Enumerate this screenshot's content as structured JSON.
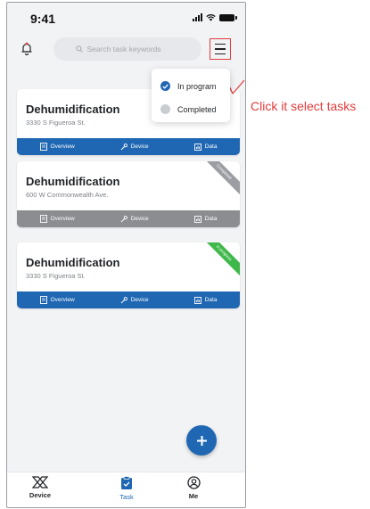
{
  "status_bar": {
    "time": "9:41"
  },
  "header": {
    "search_placeholder": "Search task keywords",
    "icons": {
      "notification": "bell-alert-icon",
      "menu": "hamburger-menu-icon",
      "search": "search-icon"
    }
  },
  "filter_menu": {
    "options": [
      {
        "label": "In program",
        "checked": true
      },
      {
        "label": "Completed",
        "checked": false
      }
    ]
  },
  "tasks": [
    {
      "title": "Dehumidification",
      "address": "3330 S Figueroa St.",
      "status": "",
      "bar_color": "#1f67b2",
      "ribbon_color": "",
      "actions": [
        "Overview",
        "Device",
        "Data"
      ]
    },
    {
      "title": "Dehumidification",
      "address": "600 W Commonwealth Ave.",
      "status": "Completed",
      "bar_color": "#8b8d91",
      "ribbon_color": "#9a9da1",
      "actions": [
        "Overview",
        "Device",
        "Data"
      ]
    },
    {
      "title": "Dehumidification",
      "address": "3330 S Figueroa St.",
      "status": "In progress",
      "bar_color": "#1f67b2",
      "ribbon_color": "#3fb84a",
      "actions": [
        "Overview",
        "Device",
        "Data"
      ]
    }
  ],
  "bottom_nav": {
    "items": [
      {
        "label": "Device",
        "icon": "device-logo-icon",
        "active": false
      },
      {
        "label": "Task",
        "icon": "clipboard-check-icon",
        "active": true
      },
      {
        "label": "Me",
        "icon": "user-circle-icon",
        "active": false
      }
    ]
  },
  "annotation": {
    "text": "Click it select tasks",
    "color": "#e23b3b"
  },
  "colors": {
    "accent": "#1f67b2",
    "completed": "#8b8d91",
    "in_progress": "#3fb84a",
    "annotation": "#e23b3b"
  }
}
